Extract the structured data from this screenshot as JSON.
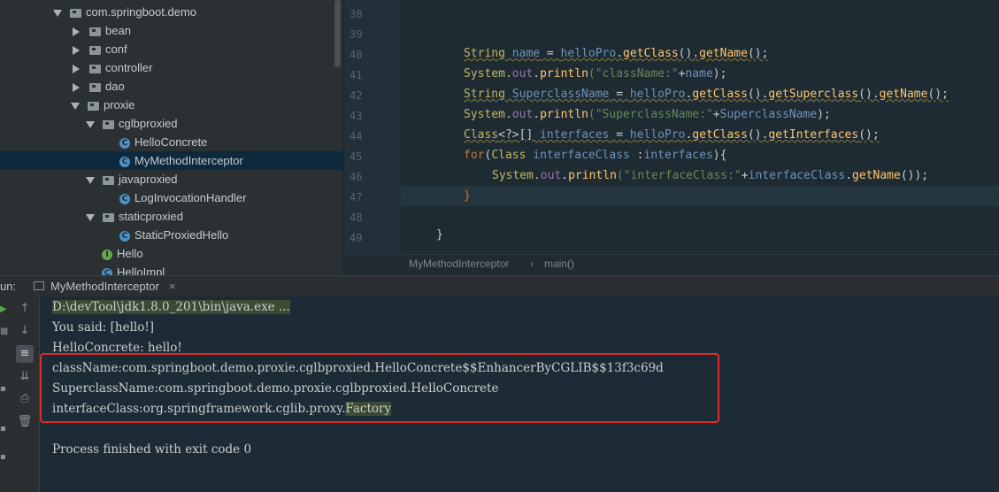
{
  "project_tree": {
    "nodes": [
      {
        "label": "com.springboot.demo",
        "kind": "package",
        "expanded": true
      },
      {
        "label": "bean",
        "kind": "package",
        "expanded": false
      },
      {
        "label": "conf",
        "kind": "package",
        "expanded": false
      },
      {
        "label": "controller",
        "kind": "package",
        "expanded": false
      },
      {
        "label": "dao",
        "kind": "package",
        "expanded": false
      },
      {
        "label": "proxie",
        "kind": "package",
        "expanded": true
      },
      {
        "label": "cglbproxied",
        "kind": "package",
        "expanded": true
      },
      {
        "label": "HelloConcrete",
        "kind": "class"
      },
      {
        "label": "MyMethodInterceptor",
        "kind": "class",
        "selected": true
      },
      {
        "label": "javaproxied",
        "kind": "package",
        "expanded": true
      },
      {
        "label": "LogInvocationHandler",
        "kind": "class"
      },
      {
        "label": "staticproxied",
        "kind": "package",
        "expanded": true
      },
      {
        "label": "StaticProxiedHello",
        "kind": "class"
      },
      {
        "label": "Hello",
        "kind": "interface"
      },
      {
        "label": "HelloImpl",
        "kind": "class"
      }
    ]
  },
  "editor": {
    "line_numbers": [
      "38",
      "39",
      "40",
      "41",
      "42",
      "43",
      "44",
      "45",
      "46",
      "47",
      "48",
      "49"
    ],
    "code": {
      "l40": {
        "t1": "String",
        "t2": " name",
        "t3": " = ",
        "t4": "helloPro",
        "t5": ".",
        "t6": "getClass",
        "t7": "().",
        "t8": "getName",
        "t9": "();"
      },
      "l41": {
        "t1": "System.",
        "t2": "out",
        "t3": ".",
        "t4": "println",
        "t5": "(\"className:\"",
        "t6": "+",
        "t7": "name",
        "t8": ");"
      },
      "l42": {
        "t1": "String",
        "t2": " SuperclassName",
        "t3": " = ",
        "t4": "helloPro",
        "t5": ".",
        "t6": "getClass",
        "t7": "().",
        "t8": "getSuperclass",
        "t9": "().",
        "t10": "getName",
        "t11": "();"
      },
      "l43": {
        "t1": "System.",
        "t2": "out",
        "t3": ".",
        "t4": "println",
        "t5": "(\"SuperclassName:\"",
        "t6": "+",
        "t7": "SuperclassName",
        "t8": ");"
      },
      "l44": {
        "t1": "Class",
        "t2": "<?>[] ",
        "t3": "interfaces",
        "t4": " = ",
        "t5": "helloPro",
        "t6": ".",
        "t7": "getClass",
        "t8": "().",
        "t9": "getInterfaces",
        "t10": "();"
      },
      "l45": {
        "t1": "for",
        "t2": "(",
        "t3": "Class",
        "t4": " interfaceClass",
        "t5": " :",
        "t6": "interfaces",
        "t7": "){"
      },
      "l46": {
        "t1": "System.",
        "t2": "out",
        "t3": ".",
        "t4": "println",
        "t5": "(\"interfaceClass:\"",
        "t6": "+",
        "t7": "interfaceClass",
        "t8": ".",
        "t9": "getName",
        "t10": "());"
      },
      "l47": {
        "t1": "}"
      },
      "l49": {
        "t1": "}"
      }
    }
  },
  "breadcrumb": {
    "class_name": "MyMethodInterceptor",
    "separator": "›",
    "method": "main()"
  },
  "run_panel": {
    "label": "un:",
    "tab_title": "MyMethodInterceptor",
    "tab_close": "×",
    "console_lines": {
      "cmd": "D:\\devTool\\jdk1.8.0_201\\bin\\java.exe ...",
      "l1": "You said: [hello!]",
      "l2": "HelloConcrete: hello!",
      "l3": "className:com.springboot.demo.proxie.cglbproxied.HelloConcrete$$EnhancerByCGLIB$$13f3c69d",
      "l4": "SuperclassName:com.springboot.demo.proxie.cglbproxied.HelloConcrete",
      "l5_prefix": "interfaceClass:org.springframework.cglib.proxy.",
      "l5_highlight": "Factory",
      "l6": "Process finished with exit code 0"
    }
  },
  "colors": {
    "keyword": "#cc7832",
    "type": "#c3b85f",
    "highlight_box": "#e02a2a"
  }
}
